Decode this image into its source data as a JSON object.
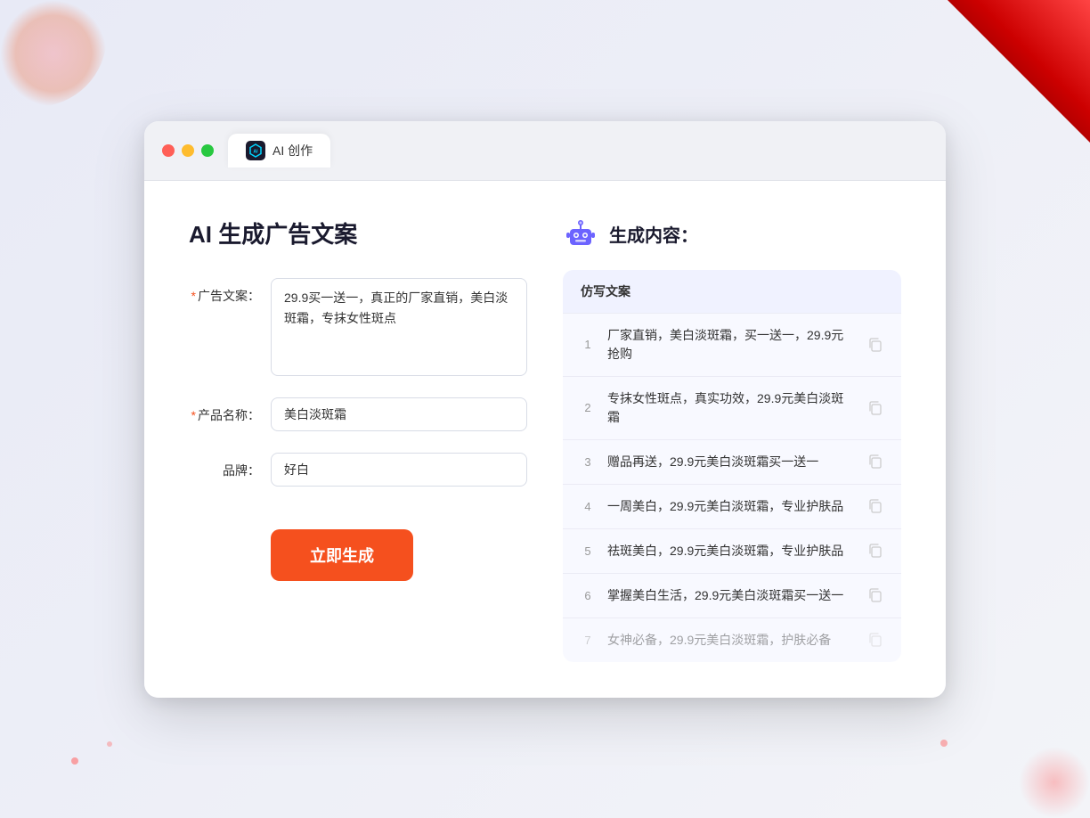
{
  "window": {
    "tab_label": "AI 创作",
    "tab_icon_text": "AI"
  },
  "left_panel": {
    "title": "AI 生成广告文案",
    "form": {
      "ad_copy_label": "广告文案：",
      "ad_copy_required": "*",
      "ad_copy_value": "29.9买一送一，真正的厂家直销，美白淡斑霜，专抹女性斑点",
      "product_name_label": "产品名称：",
      "product_name_required": "*",
      "product_name_value": "美白淡斑霜",
      "brand_label": "品牌：",
      "brand_value": "好白"
    },
    "generate_button": "立即生成"
  },
  "right_panel": {
    "title": "生成内容：",
    "results_header": "仿写文案",
    "results": [
      {
        "num": "1",
        "text": "厂家直销，美白淡斑霜，买一送一，29.9元抢购",
        "faded": false
      },
      {
        "num": "2",
        "text": "专抹女性斑点，真实功效，29.9元美白淡斑霜",
        "faded": false
      },
      {
        "num": "3",
        "text": "赠品再送，29.9元美白淡斑霜买一送一",
        "faded": false
      },
      {
        "num": "4",
        "text": "一周美白，29.9元美白淡斑霜，专业护肤品",
        "faded": false
      },
      {
        "num": "5",
        "text": "祛斑美白，29.9元美白淡斑霜，专业护肤品",
        "faded": false
      },
      {
        "num": "6",
        "text": "掌握美白生活，29.9元美白淡斑霜买一送一",
        "faded": false
      },
      {
        "num": "7",
        "text": "女神必备，29.9元美白淡斑霜，护肤必备",
        "faded": true
      }
    ]
  },
  "colors": {
    "accent": "#f5501e",
    "tab_bg": "#1a1a2e",
    "tab_icon_color": "#00d4ff"
  }
}
